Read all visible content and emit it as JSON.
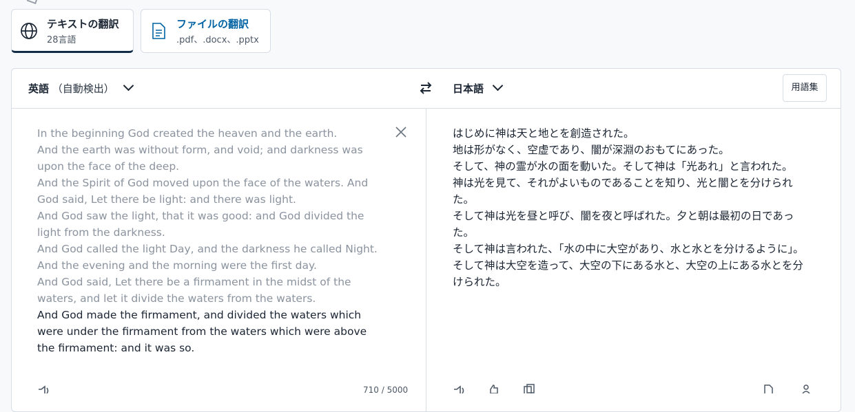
{
  "tabs": {
    "text": {
      "title": "テキストの翻訳",
      "sub": "28言語",
      "icon": "globe-icon"
    },
    "file": {
      "title": "ファイルの翻訳",
      "sub": ".pdf、.docx、.pptx",
      "icon": "document-icon"
    }
  },
  "header": {
    "source_lang": "英語",
    "source_auto": "（自動検出）",
    "target_lang": "日本語",
    "glossary_label": "用語集"
  },
  "source": {
    "lines_gray": [
      "In the beginning God created the heaven and the earth.",
      "And the earth was without form, and void; and darkness was upon the face of the deep.",
      "And the Spirit of God moved upon the face of the waters. And God said, Let there be light: and there was light.",
      "And God saw the light, that it was good: and God divided the light from the darkness.",
      "And God called the light Day, and the darkness he called Night. And the evening and the morning were the first day.",
      "And God said, Let there be a firmament in the midst of the waters, and let it divide the waters from the waters."
    ],
    "line_active": "And God made the firmament, and divided the waters which were under the firmament from the waters which were above the firmament: and it was so.",
    "char_count": "710 / 5000"
  },
  "target": {
    "lines": [
      "はじめに神は天と地とを創造された。",
      "地は形がなく、空虚であり、闇が深淵のおもてにあった。",
      "そして、神の霊が水の面を動いた。そして神は「光あれ」と言われた。",
      "神は光を見て、それがよいものであることを知り、光と闇とを分けられた。",
      "そして神は光を昼と呼び、闇を夜と呼ばれた。夕と朝は最初の日であった。",
      "そして神は言われた、「水の中に大空があり、水と水とを分けるように」。",
      "そして神は大空を造って、大空の下にある水と、大空の上にある水とを分けられた。"
    ]
  },
  "colors": {
    "accent": "#0f2b46",
    "link": "#0063a3",
    "muted_text": "#8a939e"
  }
}
